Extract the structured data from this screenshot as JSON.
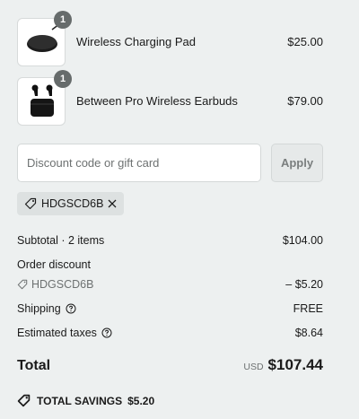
{
  "cart": {
    "items": [
      {
        "name": "Wireless Charging Pad",
        "price": "$25.00",
        "quantity": "1"
      },
      {
        "name": "Between Pro Wireless Earbuds",
        "price": "$79.00",
        "quantity": "1"
      }
    ]
  },
  "discount": {
    "placeholder": "Discount code or gift card",
    "apply_label": "Apply",
    "applied_code": "HDGSCD6B"
  },
  "summary": {
    "subtotal_label": "Subtotal · 2 items",
    "subtotal_value": "$104.00",
    "order_discount_label": "Order discount",
    "discount_code": "HDGSCD6B",
    "discount_value": "– $5.20",
    "shipping_label": "Shipping",
    "shipping_value": "FREE",
    "taxes_label": "Estimated taxes",
    "taxes_value": "$8.64",
    "total_label": "Total",
    "currency": "USD",
    "total_value": "$107.44",
    "savings_label": "TOTAL SAVINGS",
    "savings_value": "$5.20"
  },
  "icons": {
    "tag": "tag-icon",
    "close": "close-icon",
    "help": "help-circle-icon",
    "savings": "savings-tag-icon"
  },
  "colors": {
    "background": "#edf0f0",
    "badge": "#666b6b",
    "muted_text": "#6d7171"
  }
}
